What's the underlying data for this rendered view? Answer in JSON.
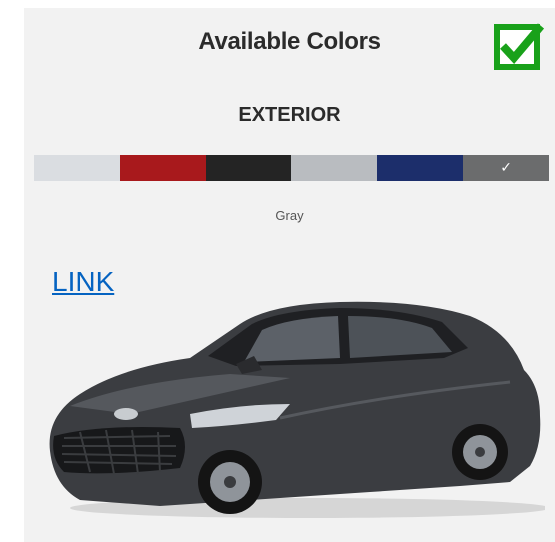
{
  "header": {
    "title": "Available Colors"
  },
  "section": {
    "label": "EXTERIOR"
  },
  "swatches": [
    {
      "color": "#dadde1",
      "selected": false
    },
    {
      "color": "#a8191c",
      "selected": false
    },
    {
      "color": "#242424",
      "selected": false
    },
    {
      "color": "#b9bcc0",
      "selected": false
    },
    {
      "color": "#1c2e6b",
      "selected": false
    },
    {
      "color": "#6b6c6d",
      "selected": true,
      "mark": "✓"
    }
  ],
  "selected": {
    "name": "Gray"
  },
  "link": {
    "text": "LINK"
  },
  "checkbox": {
    "icon": "green-checkbox-icon",
    "color": "#19a11a"
  },
  "vehicle": {
    "icon": "gray-sedan-image",
    "color": "#3b3d41"
  }
}
